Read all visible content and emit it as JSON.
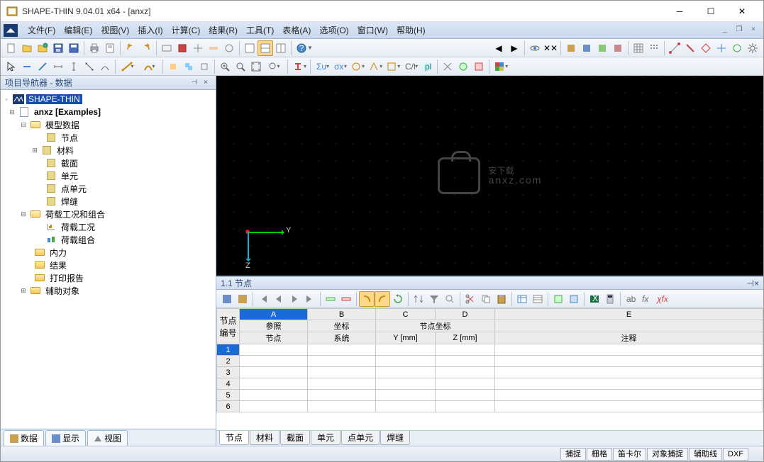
{
  "title": "SHAPE-THIN 9.04.01 x64 - [anxz]",
  "menu": [
    "文件(F)",
    "编辑(E)",
    "视图(V)",
    "插入(I)",
    "计算(C)",
    "结果(R)",
    "工具(T)",
    "表格(A)",
    "选项(O)",
    "窗口(W)",
    "帮助(H)"
  ],
  "navigator": {
    "title": "项目导航器 - 数据",
    "root": "SHAPE-THIN",
    "project": "anxz [Examples]",
    "model_data": "模型数据",
    "nodes": "节点",
    "materials": "材料",
    "sections": "截面",
    "elements": "单元",
    "point_elements": "点单元",
    "welds": "焊缝",
    "load_cases_combos": "荷载工况和组合",
    "load_cases": "荷载工况",
    "load_combos": "荷载组合",
    "internal_forces": "内力",
    "results": "结果",
    "print_report": "打印报告",
    "aux_objects": "辅助对象",
    "tabs": [
      "数据",
      "显示",
      "视图"
    ]
  },
  "viewport": {
    "y_label": "Y",
    "z_label": "Z",
    "watermark_main": "安下载",
    "watermark_sub": "anxz.com"
  },
  "table": {
    "title": "1.1 节点",
    "col_letters": [
      "A",
      "B",
      "C",
      "D",
      "E"
    ],
    "row_header_top": "节点",
    "row_header_bottom": "编号",
    "headers_row1": {
      "A": "参照",
      "B": "坐标",
      "CD": "节点坐标",
      "E": ""
    },
    "headers_row2": {
      "A": "节点",
      "B": "系统",
      "C": "Y [mm]",
      "D": "Z [mm]",
      "E": "注释"
    },
    "rows": [
      "1",
      "2",
      "3",
      "4",
      "5",
      "6"
    ],
    "tabs": [
      "节点",
      "材料",
      "截面",
      "单元",
      "点单元",
      "焊缝"
    ]
  },
  "status": [
    "捕捉",
    "栅格",
    "笛卡尔",
    "对象捕捉",
    "辅助线",
    "DXF"
  ]
}
